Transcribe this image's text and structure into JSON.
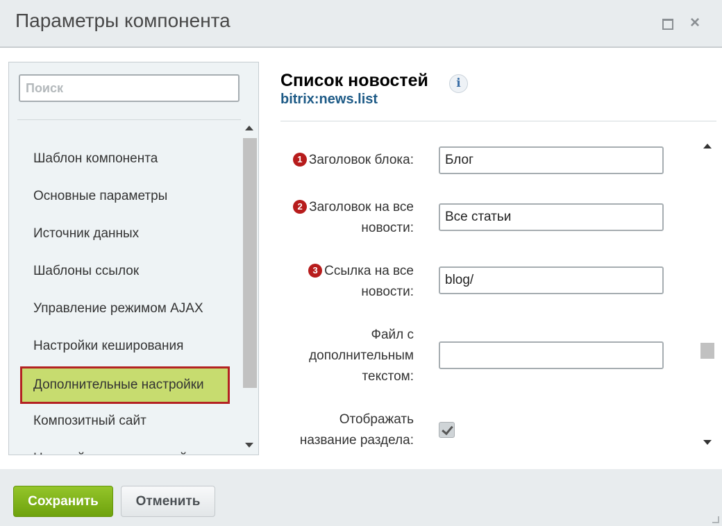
{
  "dialog": {
    "title": "Параметры компонента",
    "maximize_icon": "maximize-icon",
    "close_icon": "close-icon",
    "close_glyph": "×"
  },
  "sidebar": {
    "search_placeholder": "Поиск",
    "items": [
      {
        "label": "Шаблон компонента"
      },
      {
        "label": "Основные параметры"
      },
      {
        "label": "Источник данных"
      },
      {
        "label": "Шаблоны ссылок"
      },
      {
        "label": "Управление режимом AJAX"
      },
      {
        "label": "Настройки кеширования"
      },
      {
        "label": "Дополнительные настройки",
        "active": true
      },
      {
        "label": "Композитный сайт"
      },
      {
        "label": "Настройки постраничной"
      }
    ]
  },
  "component": {
    "title": "Список новостей",
    "code": "bitrix:news.list",
    "info_glyph": "i"
  },
  "fields": [
    {
      "badge": "1",
      "label": "Заголовок блока:",
      "value": "Блог"
    },
    {
      "badge": "2",
      "label_lines": [
        "Заголовок на все",
        "новости:"
      ],
      "value": "Все статьи"
    },
    {
      "badge": "3",
      "label_lines": [
        "Ссылка на все",
        "новости:"
      ],
      "value": "blog/"
    },
    {
      "label_lines": [
        "Файл с",
        "дополнительным",
        "текстом:"
      ],
      "value": ""
    },
    {
      "label_lines": [
        "Отображать",
        "название раздела:"
      ],
      "checked": true
    }
  ],
  "footer": {
    "save_label": "Сохранить",
    "cancel_label": "Отменить"
  },
  "colors": {
    "active_item_bg": "#c7dc6f",
    "active_item_border": "#b32222",
    "badge": "#b71c1c",
    "save_button": "#7bb110",
    "code_link": "#1d5a86"
  }
}
